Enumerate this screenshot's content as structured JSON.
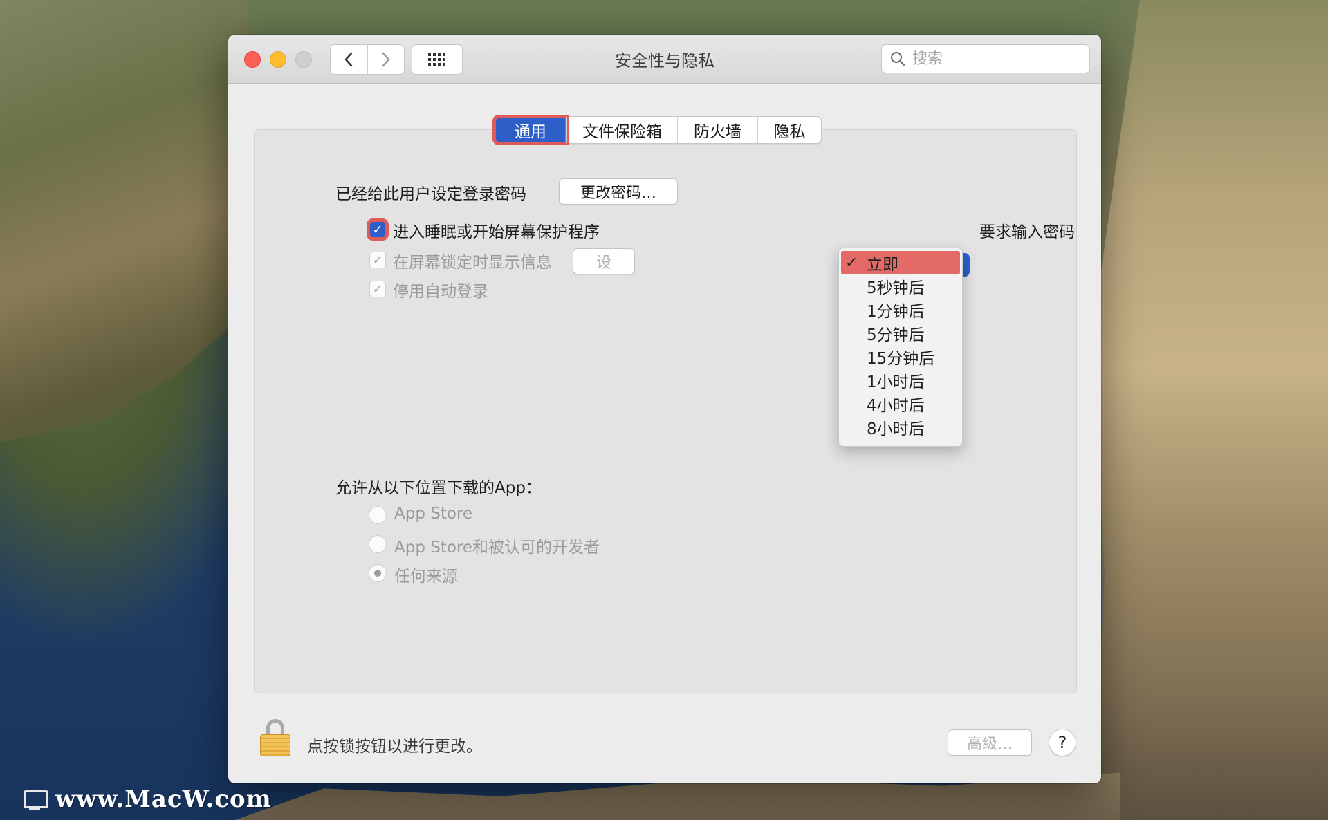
{
  "window": {
    "title": "安全性与隐私",
    "search_placeholder": "搜索"
  },
  "tabs": [
    {
      "label": "通用",
      "active": true
    },
    {
      "label": "文件保险箱",
      "active": false
    },
    {
      "label": "防火墙",
      "active": false
    },
    {
      "label": "隐私",
      "active": false
    }
  ],
  "general": {
    "password_set_label": "已经给此用户设定登录密码",
    "change_password_button": "更改密码…",
    "require_password_prefix": "进入睡眠或开始屏幕保护程序",
    "require_password_suffix": "要求输入密码",
    "show_message_label": "在屏幕锁定时显示信息",
    "set_message_button": "设",
    "disable_autologin_label": "停用自动登录"
  },
  "dropdown": {
    "selected": "立即",
    "options": [
      "立即",
      "5秒钟后",
      "1分钟后",
      "5分钟后",
      "15分钟后",
      "1小时后",
      "4小时后",
      "8小时后"
    ]
  },
  "downloads": {
    "heading": "允许从以下位置下载的App：",
    "options": [
      {
        "label": "App Store",
        "selected": false
      },
      {
        "label": "App Store和被认可的开发者",
        "selected": false
      },
      {
        "label": "任何来源",
        "selected": true
      }
    ]
  },
  "footer": {
    "lock_text": "点按锁按钮以进行更改。",
    "advanced_button": "高级…",
    "help_button": "?"
  },
  "watermark": "www.MacW.com",
  "colors": {
    "accent": "#2e5fc9",
    "highlight": "#e05a5a",
    "close": "#fe5f57",
    "minimize": "#febc2e"
  }
}
